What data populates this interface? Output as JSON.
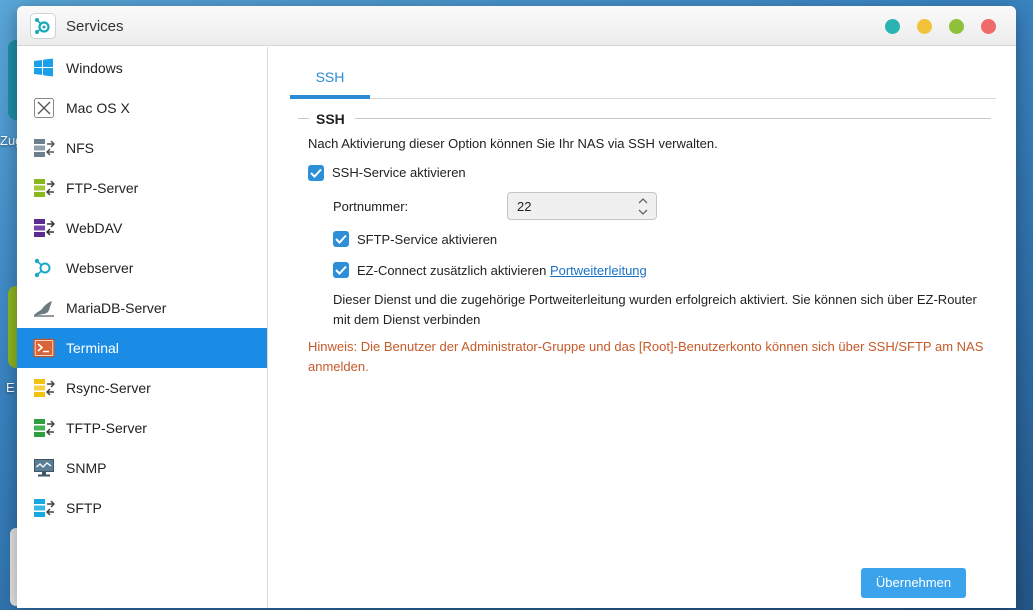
{
  "window": {
    "title": "Services",
    "controls": [
      {
        "name": "info",
        "color": "#2bb3b3"
      },
      {
        "name": "minimize",
        "color": "#f2c23b"
      },
      {
        "name": "maximize",
        "color": "#8fc23a"
      },
      {
        "name": "close",
        "color": "#ef6b6b"
      }
    ]
  },
  "desktop": {
    "labels": [
      "Zug",
      "E"
    ]
  },
  "sidebar": {
    "items": [
      {
        "label": "Windows",
        "icon": "windows-icon"
      },
      {
        "label": "Mac OS X",
        "icon": "macos-icon"
      },
      {
        "label": "NFS",
        "icon": "nfs-icon"
      },
      {
        "label": "FTP-Server",
        "icon": "ftp-server-icon"
      },
      {
        "label": "WebDAV",
        "icon": "webdav-icon"
      },
      {
        "label": "Webserver",
        "icon": "webserver-icon"
      },
      {
        "label": "MariaDB-Server",
        "icon": "mariadb-icon"
      },
      {
        "label": "Terminal",
        "icon": "terminal-icon",
        "active": true
      },
      {
        "label": "Rsync-Server",
        "icon": "rsync-icon"
      },
      {
        "label": "TFTP-Server",
        "icon": "tftp-icon"
      },
      {
        "label": "SNMP",
        "icon": "snmp-icon"
      },
      {
        "label": "SFTP",
        "icon": "sftp-icon"
      }
    ]
  },
  "main": {
    "tabs": [
      {
        "label": "SSH",
        "active": true
      }
    ],
    "section_title": "SSH",
    "description": "Nach Aktivierung dieser Option können Sie Ihr NAS via SSH verwalten.",
    "ssh_service": {
      "label": "SSH-Service aktivieren",
      "checked": true
    },
    "port": {
      "label": "Portnummer:",
      "value": "22"
    },
    "sftp_service": {
      "label": "SFTP-Service aktivieren",
      "checked": true
    },
    "ez_connect": {
      "label": "EZ-Connect zusätzlich aktivieren",
      "link": "Portweiterleitung",
      "checked": true
    },
    "note": "Dieser Dienst und die zugehörige Portweiterleitung wurden erfolgreich aktiviert. Sie können sich über EZ-Router mit dem Dienst verbinden",
    "hint": "Hinweis: Die Benutzer der Administrator-Gruppe und das [Root]-Benutzerkonto können sich über SSH/SFTP am NAS anmelden.",
    "apply_label": "Übernehmen"
  },
  "colors": {
    "accent": "#1a8ce6",
    "hint": "#c65a2a",
    "apply": "#3aa3ec"
  }
}
